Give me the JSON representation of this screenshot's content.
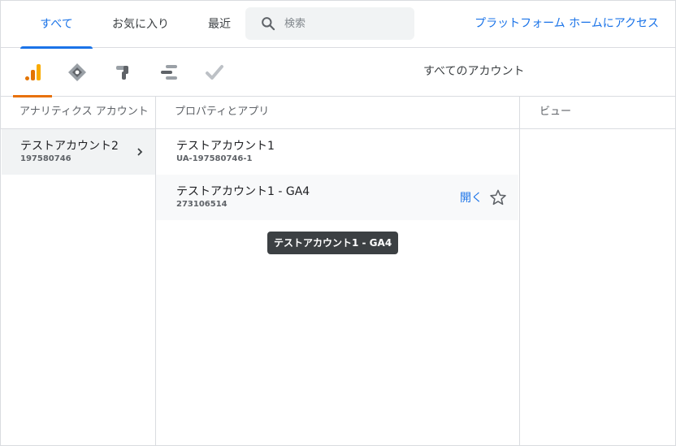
{
  "colors": {
    "accent": "#1a73e8",
    "product_indicator": "#e8710a"
  },
  "tabs": [
    {
      "label": "すべて",
      "active": true
    },
    {
      "label": "お気に入り",
      "active": false
    },
    {
      "label": "最近",
      "active": false
    }
  ],
  "search": {
    "placeholder": "検索",
    "value": "",
    "icon": "search-icon"
  },
  "platform_link": "プラットフォーム ホームにアクセス",
  "products": [
    {
      "icon": "analytics-icon",
      "active": true
    },
    {
      "icon": "tag-manager-icon",
      "active": false
    },
    {
      "icon": "optimize-icon",
      "active": false
    },
    {
      "icon": "surveys-icon",
      "active": false
    },
    {
      "icon": "data-studio-icon",
      "active": false
    }
  ],
  "scope_title": "すべてのアカウント",
  "columns": {
    "accounts": "アナリティクス アカウント",
    "properties": "プロパティとアプリ",
    "views": "ビュー"
  },
  "accounts": [
    {
      "name": "テストアカウント2",
      "id": "197580746",
      "selected": true
    }
  ],
  "properties": [
    {
      "name": "テストアカウント1",
      "id": "UA-197580746-1"
    },
    {
      "name": "テストアカウント1 - GA4",
      "id": "273106514",
      "open_label": "開く",
      "hovered": true
    }
  ],
  "tooltip": "テストアカウント1 - GA4"
}
